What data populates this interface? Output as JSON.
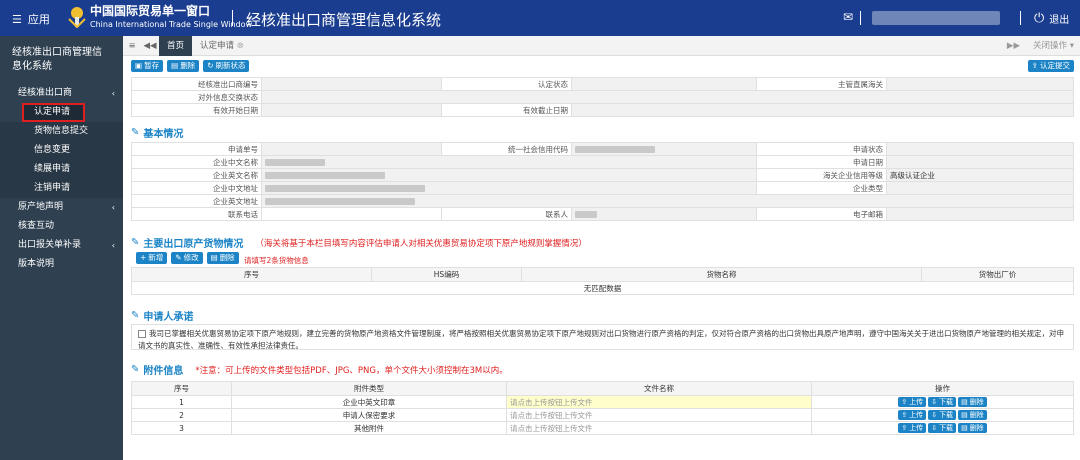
{
  "topbar": {
    "menu_label": "应用",
    "brand_cn": "中国国际贸易单一窗口",
    "brand_en": "China International Trade Single Window",
    "system_title": "经核准出口商管理信息化系统",
    "logout_label": "退出",
    "bg_color": "#1a3d8f"
  },
  "sidebar": {
    "system_name": "经核准出口商管理信息化系统",
    "items": [
      {
        "label": "经核准出口商",
        "arrow": "‹"
      },
      {
        "label": "认定申请"
      },
      {
        "label": "货物信息提交"
      },
      {
        "label": "信息变更"
      },
      {
        "label": "续展申请"
      },
      {
        "label": "注销申请"
      },
      {
        "label": "原产地声明",
        "arrow": "‹"
      },
      {
        "label": "核查互动"
      },
      {
        "label": "出口报关单补录",
        "arrow": "‹"
      },
      {
        "label": "版本说明"
      }
    ]
  },
  "tabbar": {
    "home": "首页",
    "current": "认定申请",
    "close_ops": "关闭操作"
  },
  "toolbar": {
    "save": "暂存",
    "delete": "删除",
    "refresh": "刷新状态",
    "confirm": "认定提交"
  },
  "header_table": {
    "l1": "经核准出口商编号",
    "l2": "认定状态",
    "l3": "主管直属海关",
    "l4": "对外信息交换状态",
    "l5": "有效开始日期",
    "l6": "有效截止日期"
  },
  "basic": {
    "title": "基本情况",
    "apply_no": "申请单号",
    "credit_code": "统一社会信用代码",
    "apply_status": "申请状态",
    "cn_name": "企业中文名称",
    "apply_date": "申请日期",
    "en_name": "企业英文名称",
    "credit_level": "海关企业信用等级",
    "credit_level_value": "高级认证企业",
    "cn_address": "企业中文地址",
    "company_type": "企业类型",
    "en_address": "企业英文地址",
    "phone": "联系电话",
    "contact": "联系人",
    "email": "电子邮箱"
  },
  "goods": {
    "title": "主要出口原产货物情况",
    "warning": "（海关将基于本栏目填写内容评估申请人对相关优惠贸易协定项下原产地规则掌握情况）",
    "add": "新增",
    "edit": "修改",
    "delete": "删除",
    "note": "请填写2条货物信息",
    "columns": [
      "序号",
      "HS编码",
      "货物名称",
      "货物出厂价"
    ],
    "empty": "无匹配数据"
  },
  "pledge": {
    "title": "申请人承诺",
    "text": "我司已掌握相关优惠贸易协定项下原产地规则，建立完善的货物原产地资格文件管理制度，将严格按照相关优惠贸易协定项下原产地规则对出口货物进行原产资格的判定，仅对符合原产资格的出口货物出具原产地声明，遵守中国海关关于进出口货物原产地管理的相关规定，对申请文书的真实性、准确性、有效性承担法律责任。"
  },
  "attach": {
    "title": "附件信息",
    "warning": "*注意：可上传的文件类型包括PDF、JPG、PNG，单个文件大小须控制在3M以内。",
    "columns": [
      "序号",
      "附件类型",
      "文件名称",
      "操作"
    ],
    "rows": [
      {
        "no": "1",
        "type": "企业中英文印章",
        "file": "请点击上传按钮上传文件"
      },
      {
        "no": "2",
        "type": "申请人保密要求",
        "file": "请点击上传按钮上传文件"
      },
      {
        "no": "3",
        "type": "其他附件",
        "file": "请点击上传按钮上传文件"
      }
    ],
    "upload": "上传",
    "download": "下载",
    "delete": "删除"
  }
}
